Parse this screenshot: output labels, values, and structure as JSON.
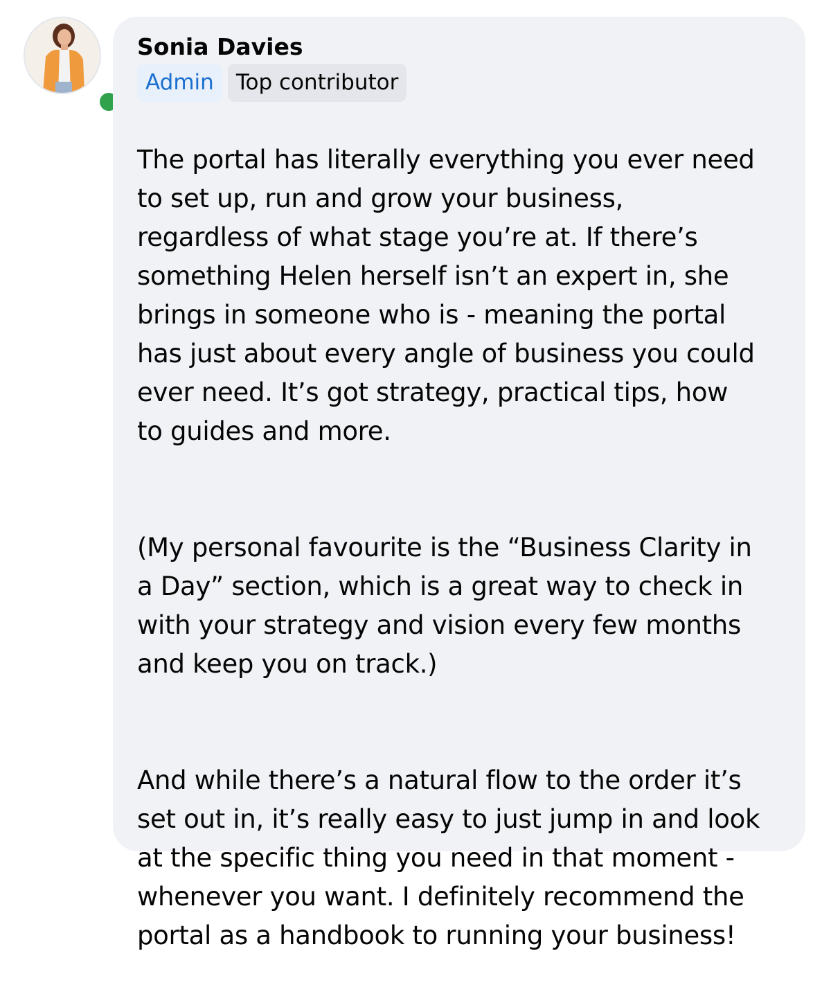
{
  "comment": {
    "author": "Sonia Davies",
    "avatar_icon": "profile-photo",
    "online_status_color": "#31a24c",
    "badges": {
      "admin": "Admin",
      "top_contributor": "Top contributor"
    },
    "paragraphs": [
      "The portal has literally everything you ever need\nto set up, run and grow your business,\nregardless of what stage you’re at.  If there’s\nsomething Helen herself isn’t an expert in, she\nbrings in someone who is - meaning the portal\nhas just about every angle of business you could\never need.  It’s got strategy, practical tips, how\nto guides and more.",
      "(My personal favourite is the “Business Clarity in\na Day” section, which is a great way to check in\nwith your strategy and vision every few months\nand keep you on track.)",
      "And while there’s a natural flow to the order it’s\nset out in, it’s really easy to just jump in and look\nat the specific thing you need in that moment -\nwhenever you want.  I definitely recommend the\nportal as a handbook to running your business!"
    ]
  },
  "colors": {
    "bubble_background": "#f0f2f5",
    "admin_badge_text": "#1a6fcf",
    "admin_badge_background": "#e7f0fb",
    "contributor_badge_background": "#e4e6eb",
    "text": "#050505"
  }
}
